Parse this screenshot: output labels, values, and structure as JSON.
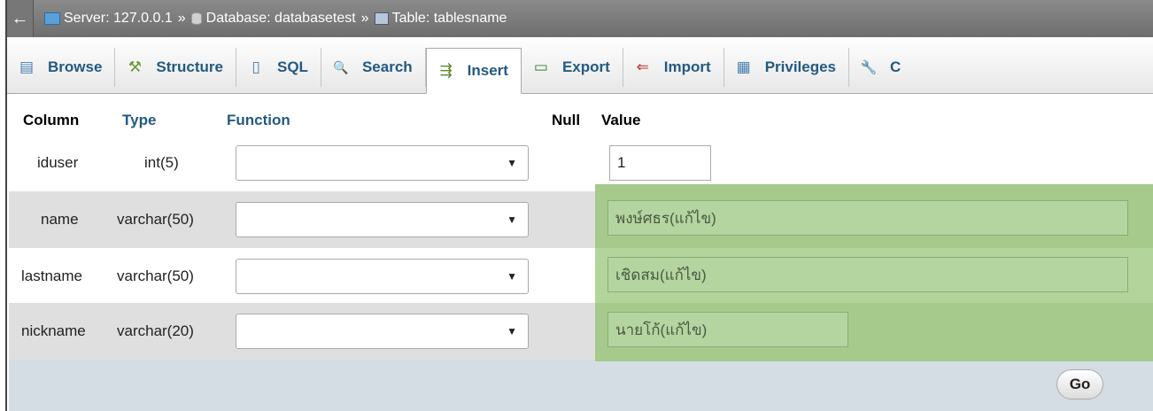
{
  "breadcrumb": {
    "back": "←",
    "server": "Server: 127.0.0.1",
    "sep1": "»",
    "database": "Database: databasetest",
    "sep2": "»",
    "table": "Table: tablesname"
  },
  "tabs": [
    {
      "label": "Browse",
      "icon": "▤"
    },
    {
      "label": "Structure",
      "icon": "⚒"
    },
    {
      "label": "SQL",
      "icon": "▯"
    },
    {
      "label": "Search",
      "icon": "🔍"
    },
    {
      "label": "Insert",
      "icon": "⇶"
    },
    {
      "label": "Export",
      "icon": "▭"
    },
    {
      "label": "Import",
      "icon": "⇐"
    },
    {
      "label": "Privileges",
      "icon": "▦"
    },
    {
      "label": "C",
      "icon": "🔧"
    }
  ],
  "active_tab": "Insert",
  "headers": {
    "column": "Column",
    "type": "Type",
    "function": "Function",
    "null": "Null",
    "value": "Value"
  },
  "rows": [
    {
      "column": "iduser",
      "type": "int(5)",
      "value": "1"
    },
    {
      "column": "name",
      "type": "varchar(50)",
      "value": "พงษ์ศธร(แก้ไข)"
    },
    {
      "column": "lastname",
      "type": "varchar(50)",
      "value": "เชิดสม(แก้ไข)"
    },
    {
      "column": "nickname",
      "type": "varchar(20)",
      "value": "นายโก้(แก้ไข)"
    }
  ],
  "go_button": "Go",
  "colors": {
    "highlight": "#b3d49b",
    "link": "#235a81",
    "topbar": "#7a7a7a"
  }
}
